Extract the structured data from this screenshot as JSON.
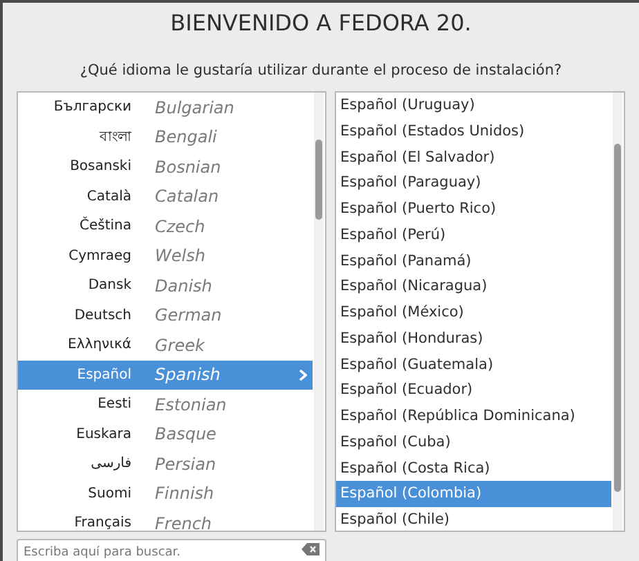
{
  "title": "BIENVENIDO A FEDORA 20.",
  "question": "¿Qué idioma le gustaría utilizar durante el proceso de instalación?",
  "languages": [
    {
      "native": "Български",
      "english": "Bulgarian",
      "selected": false
    },
    {
      "native": "বাংলা",
      "english": "Bengali",
      "selected": false
    },
    {
      "native": "Bosanski",
      "english": "Bosnian",
      "selected": false
    },
    {
      "native": "Català",
      "english": "Catalan",
      "selected": false
    },
    {
      "native": "Čeština",
      "english": "Czech",
      "selected": false
    },
    {
      "native": "Cymraeg",
      "english": "Welsh",
      "selected": false
    },
    {
      "native": "Dansk",
      "english": "Danish",
      "selected": false
    },
    {
      "native": "Deutsch",
      "english": "German",
      "selected": false
    },
    {
      "native": "Ελληνικά",
      "english": "Greek",
      "selected": false
    },
    {
      "native": "Español",
      "english": "Spanish",
      "selected": true
    },
    {
      "native": "Eesti",
      "english": "Estonian",
      "selected": false
    },
    {
      "native": "Euskara",
      "english": "Basque",
      "selected": false
    },
    {
      "native": "فارسی",
      "english": "Persian",
      "selected": false
    },
    {
      "native": "Suomi",
      "english": "Finnish",
      "selected": false
    },
    {
      "native": "Français",
      "english": "French",
      "selected": false
    }
  ],
  "locales": [
    {
      "label": "Español (Uruguay)",
      "selected": false
    },
    {
      "label": "Español (Estados Unidos)",
      "selected": false
    },
    {
      "label": "Español (El Salvador)",
      "selected": false
    },
    {
      "label": "Español (Paraguay)",
      "selected": false
    },
    {
      "label": "Español (Puerto Rico)",
      "selected": false
    },
    {
      "label": "Español (Perú)",
      "selected": false
    },
    {
      "label": "Español (Panamá)",
      "selected": false
    },
    {
      "label": "Español (Nicaragua)",
      "selected": false
    },
    {
      "label": "Español (México)",
      "selected": false
    },
    {
      "label": "Español (Honduras)",
      "selected": false
    },
    {
      "label": "Español (Guatemala)",
      "selected": false
    },
    {
      "label": "Español (Ecuador)",
      "selected": false
    },
    {
      "label": "Español (República Dominicana)",
      "selected": false
    },
    {
      "label": "Español (Cuba)",
      "selected": false
    },
    {
      "label": "Español (Costa Rica)",
      "selected": false
    },
    {
      "label": "Español (Colombia)",
      "selected": true
    },
    {
      "label": "Español (Chile)",
      "selected": false
    }
  ],
  "search": {
    "placeholder": "Escriba aquí para buscar."
  }
}
